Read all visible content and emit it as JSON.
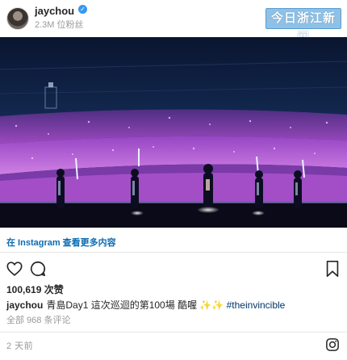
{
  "header": {
    "username": "jaychou",
    "followers": "2.3M 位粉丝",
    "news_badge": "今日浙江新闻"
  },
  "post": {
    "more_on_instagram": "在 Instagram 查看更多内容",
    "likes": "100,619 次赞",
    "caption_user": "jaychou",
    "caption_text": "青島Day1 這次巡迴的第100場 酷喔 ✨✨",
    "hashtag": "#theinvincible",
    "comments": "全部 968 条评论",
    "time": "2 天前"
  },
  "icons": [
    "heart-icon",
    "comment-icon",
    "bookmark-icon",
    "instagram-logo-icon",
    "verified-icon"
  ],
  "colors": {
    "link_blue": "#0a6bb3",
    "verified_blue": "#3897f0",
    "stage_light_purple": "#d77af0",
    "night_navy": "#0b1b37"
  }
}
